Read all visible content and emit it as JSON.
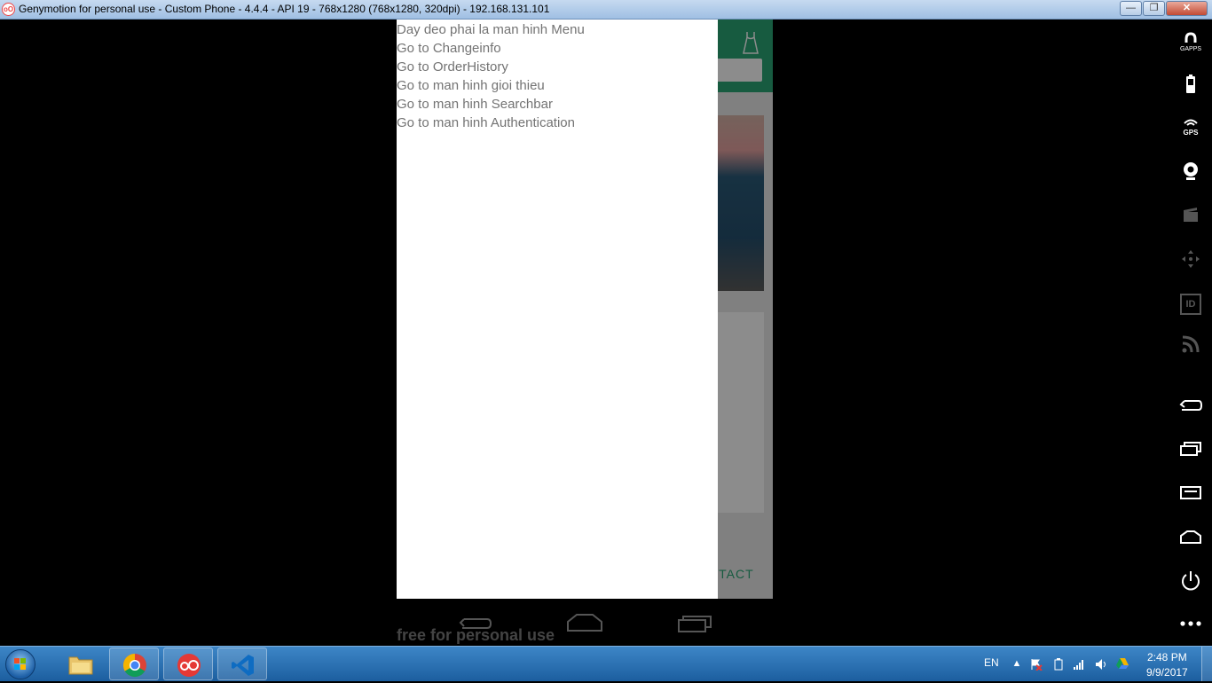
{
  "window": {
    "title": "Genymotion for personal use - Custom Phone - 4.4.4 - API 19 - 768x1280 (768x1280, 320dpi) - 192.168.131.101",
    "app_icon_text": "oO"
  },
  "drawer": {
    "items": [
      "Day deo phai la man hinh Menu",
      "Go to Changeinfo",
      "Go to OrderHistory",
      "Go to man hinh gioi thieu",
      "Go to man hinh Searchbar",
      "Go to man hinh Authentication"
    ]
  },
  "app_behind": {
    "contact_text": "NTACT"
  },
  "watermark": "free for personal use",
  "sidebar": {
    "gapps_label": "GAPPS",
    "gps_label": "GPS",
    "id_label": "ID"
  },
  "taskbar": {
    "language": "EN",
    "time": "2:48 PM",
    "date": "9/9/2017"
  },
  "colors": {
    "app_header": "#2aa676",
    "drawer_text": "#737373",
    "taskbar": "#1c5e9f"
  }
}
